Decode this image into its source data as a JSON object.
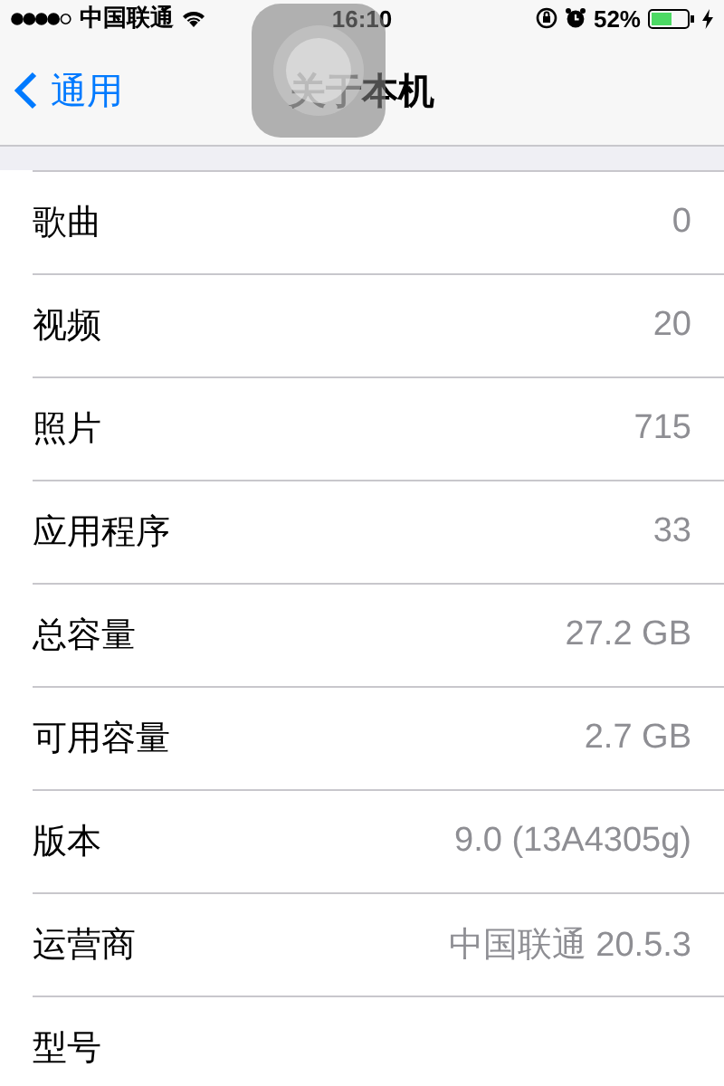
{
  "status_bar": {
    "carrier": "中国联通",
    "time": "16:10",
    "battery": "52%",
    "charging": true
  },
  "nav_bar": {
    "back": "通用",
    "title": "关于本机"
  },
  "rows": [
    {
      "label": "歌曲",
      "value": "0"
    },
    {
      "label": "视频",
      "value": "20"
    },
    {
      "label": "照片",
      "value": "715"
    },
    {
      "label": "应用程序",
      "value": "33"
    },
    {
      "label": "总容量",
      "value": "27.2 GB"
    },
    {
      "label": "可用容量",
      "value": "2.7 GB"
    },
    {
      "label": "版本",
      "value": "9.0 (13A4305g)"
    },
    {
      "label": "运营商",
      "value": "中国联通 20.5.3"
    },
    {
      "label": "型号"
    }
  ]
}
